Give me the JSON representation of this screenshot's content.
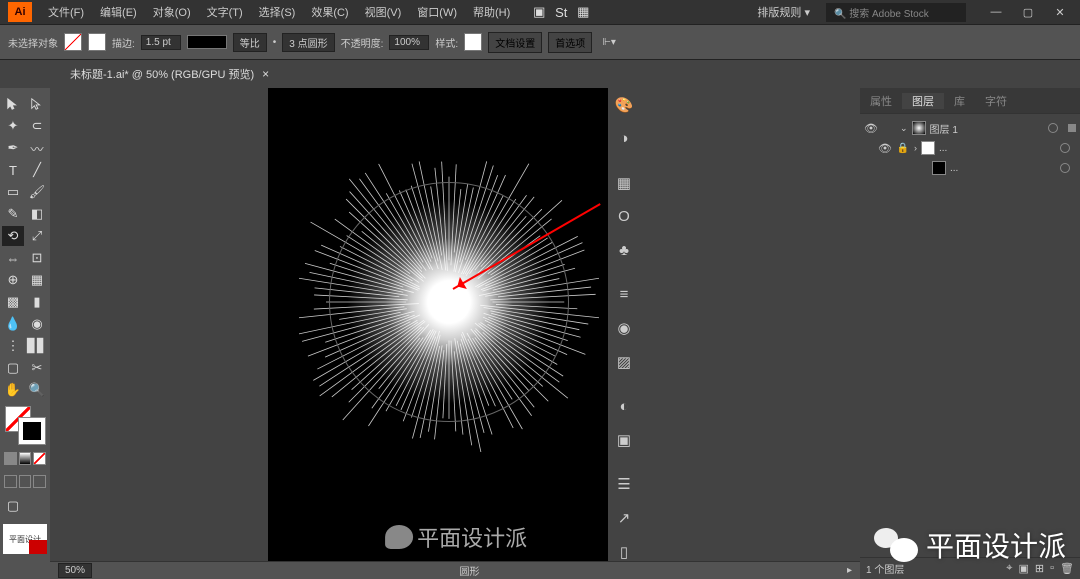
{
  "app": {
    "logo": "Ai"
  },
  "menu": {
    "file": "文件(F)",
    "edit": "编辑(E)",
    "object": "对象(O)",
    "type": "文字(T)",
    "select": "选择(S)",
    "effect": "效果(C)",
    "view": "视图(V)",
    "window": "窗口(W)",
    "help": "帮助(H)"
  },
  "topright": {
    "workspace": "排版规则",
    "search_placeholder": "搜索 Adobe Stock"
  },
  "controlbar": {
    "no_selection": "未选择对象",
    "stroke_label": "描边:",
    "stroke_width": "1.5 pt",
    "fit_label": "等比",
    "dot_pattern": "3 点圆形",
    "opacity_label": "不透明度:",
    "opacity_value": "100%",
    "style_label": "样式:",
    "doc_setup": "文档设置",
    "preferences": "首选项"
  },
  "doc_tab": {
    "title": "未标题-1.ai* @ 50% (RGB/GPU 预览)",
    "close": "×"
  },
  "layers_panel": {
    "tabs": {
      "properties": "属性",
      "layers": "图层",
      "libraries": "库",
      "characters": "字符"
    },
    "layer1": "图层 1",
    "sublayer": "...",
    "footer_count": "1 个图层"
  },
  "statusbar": {
    "zoom": "50%",
    "tool": "圆形"
  },
  "canvas_watermark": "平面设计派",
  "big_watermark": "平面设计派",
  "thumb_label": "平面设计"
}
